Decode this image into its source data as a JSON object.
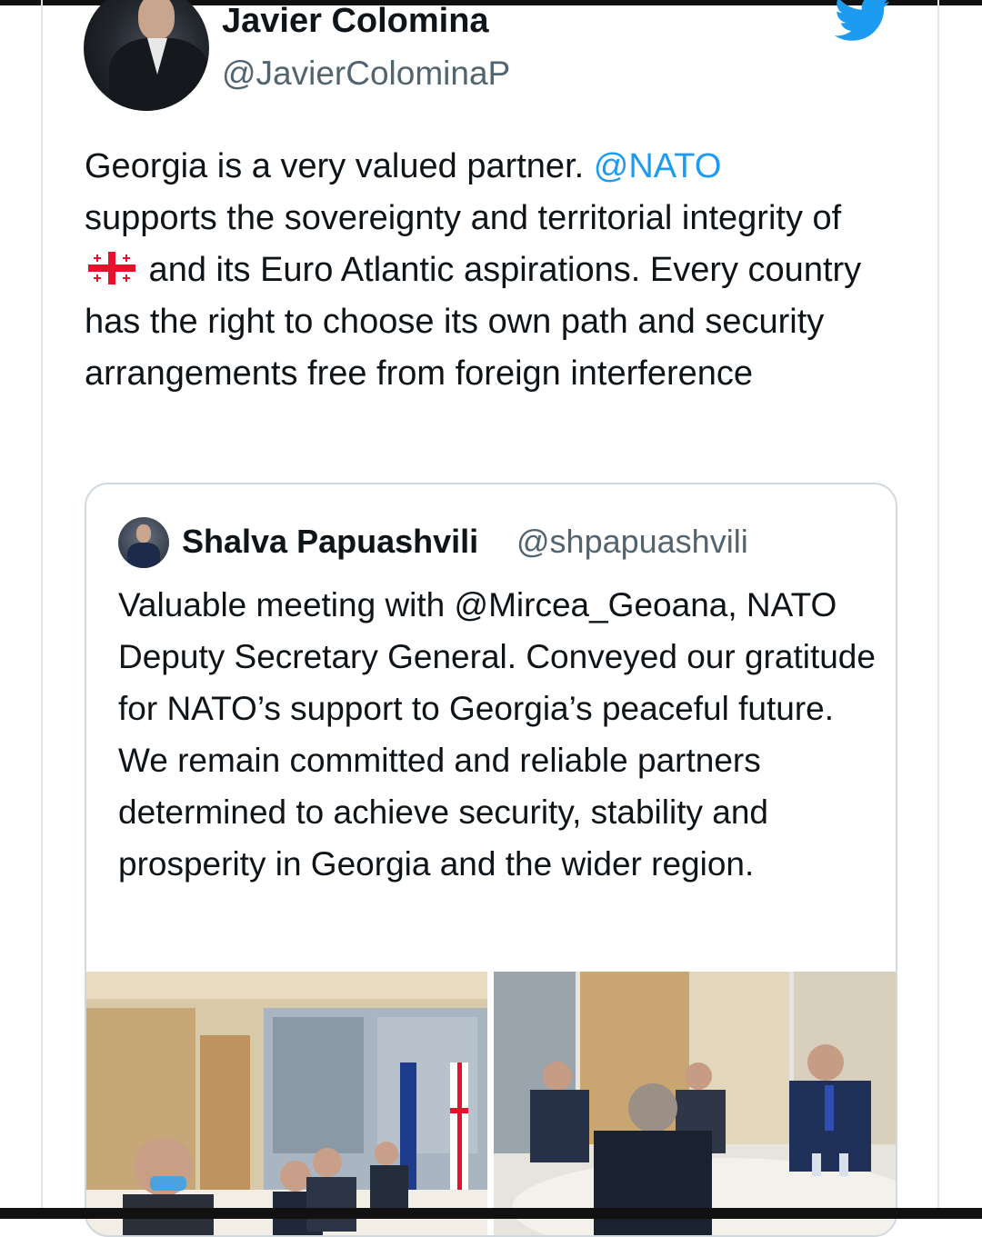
{
  "tweet": {
    "author_name": "Javier Colomina",
    "author_handle": "@JavierColominaP",
    "text_part1": "Georgia is a very valued partner. ",
    "mention": "@NATO",
    "text_part2": "supports the sovereignty and territorial integrity of ",
    "flag_icon": "georgia-flag-emoji",
    "text_part3": " and its Euro Atlantic aspirations. Every country has the right to choose its own path and security arrangements free from foreign interference"
  },
  "quoted_tweet": {
    "author_name": "Shalva Papuashvili",
    "author_handle": "@shpapuashvili",
    "text": "Valuable meeting with @Mircea_Geoana, NATO Deputy Secretary General. Conveyed our gratitude for NATO’s support to Georgia’s peaceful future. We remain committed and reliable partners determined to achieve security, stability and prosperity in Georgia and the wider region."
  },
  "colors": {
    "link": "#1d9bf0",
    "secondary_text": "#536471",
    "border": "#cfd9de",
    "twitter_blue": "#1d9bf0"
  },
  "icons": {
    "brand": "twitter-bird-icon"
  }
}
